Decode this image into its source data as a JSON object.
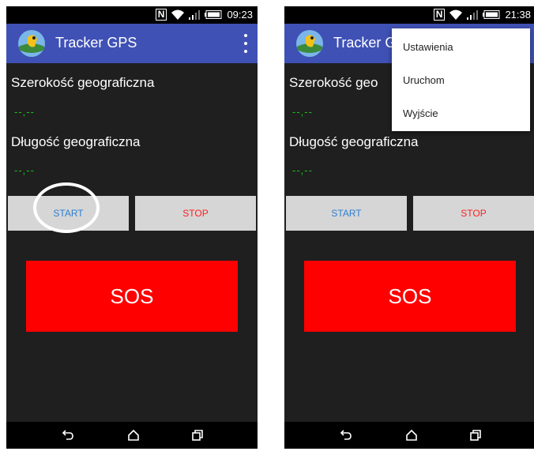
{
  "left": {
    "status": {
      "time": "09:23"
    },
    "appbar": {
      "title": "Tracker GPS"
    },
    "latitude": {
      "label": "Szerokość geograficzna",
      "value": "--,--"
    },
    "longitude": {
      "label": "Długość geograficzna",
      "value": "--,--"
    },
    "buttons": {
      "start": "START",
      "stop": "STOP",
      "sos": "SOS"
    }
  },
  "right": {
    "status": {
      "time": "21:38"
    },
    "appbar": {
      "title_visible": "Tracker G"
    },
    "latitude": {
      "label_visible": "Szerokość geo",
      "value": "--,--"
    },
    "longitude": {
      "label": "Długość geograficzna",
      "value": "--,--"
    },
    "buttons": {
      "start": "START",
      "stop": "STOP",
      "sos": "SOS"
    },
    "menu": {
      "items": [
        "Ustawienia",
        "Uruchom",
        "Wyjście"
      ]
    }
  },
  "colors": {
    "appbar": "#3f51b5",
    "background": "#1f1f1f",
    "coordinate": "#19c219",
    "start_text": "#2d7fd2",
    "stop_text": "#ff2020",
    "sos": "#ff0000"
  },
  "icons": [
    "nfc-icon",
    "wifi-icon",
    "signal-icon",
    "battery-icon",
    "app-logo-icon",
    "overflow-menu-icon",
    "back-icon",
    "home-icon",
    "recent-apps-icon"
  ]
}
